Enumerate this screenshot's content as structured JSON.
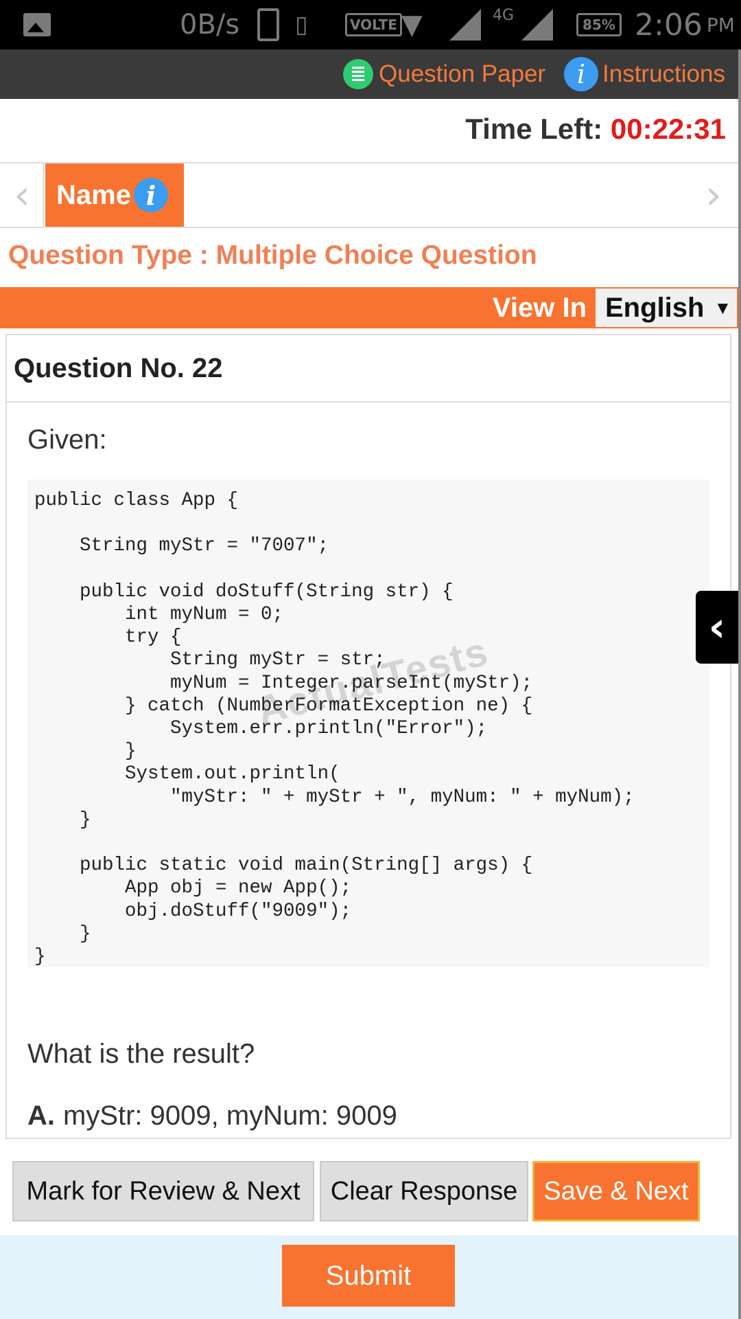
{
  "status_bar": {
    "speed": "0B/s",
    "volte": "VOLTE",
    "network": "4G",
    "battery": "85%",
    "time": "2:06",
    "ampm": "PM"
  },
  "header": {
    "question_paper_label": "Question Paper",
    "instructions_label": "Instructions"
  },
  "timer": {
    "label": "Time Left:",
    "value": "00:22:31",
    "value_color": "#e31b1b"
  },
  "section": {
    "tab_label": "Name",
    "accent_color": "#f8732f"
  },
  "question_type": "Question Type : Multiple Choice Question",
  "language": {
    "view_in_label": "View In",
    "selected": "English"
  },
  "question": {
    "number_label": "Question No. 22",
    "intro": "Given:",
    "code": "public class App {\n\n    String myStr = \"7007\";\n\n    public void doStuff(String str) {\n        int myNum = 0;\n        try {\n            String myStr = str;\n            myNum = Integer.parseInt(myStr);\n        } catch (NumberFormatException ne) {\n            System.err.println(\"Error\");\n        }\n        System.out.println(\n            \"myStr: \" + myStr + \", myNum: \" + myNum);\n    }\n\n    public static void main(String[] args) {\n        App obj = new App();\n        obj.doStuff(\"9009\");\n    }\n}",
    "watermark": "ActualTests",
    "prompt": "What is the result?",
    "options": [
      {
        "letter": "A.",
        "text": "myStr: 9009, myNum: 9009"
      }
    ]
  },
  "actions": {
    "mark_review_label": "Mark for Review & Next",
    "clear_label": "Clear Response",
    "save_next_label": "Save & Next",
    "submit_label": "Submit"
  },
  "icons": {
    "question_paper": "document-list-icon",
    "instructions": "info-icon",
    "section_info": "info-icon",
    "side_panel": "chevron-left-icon"
  }
}
